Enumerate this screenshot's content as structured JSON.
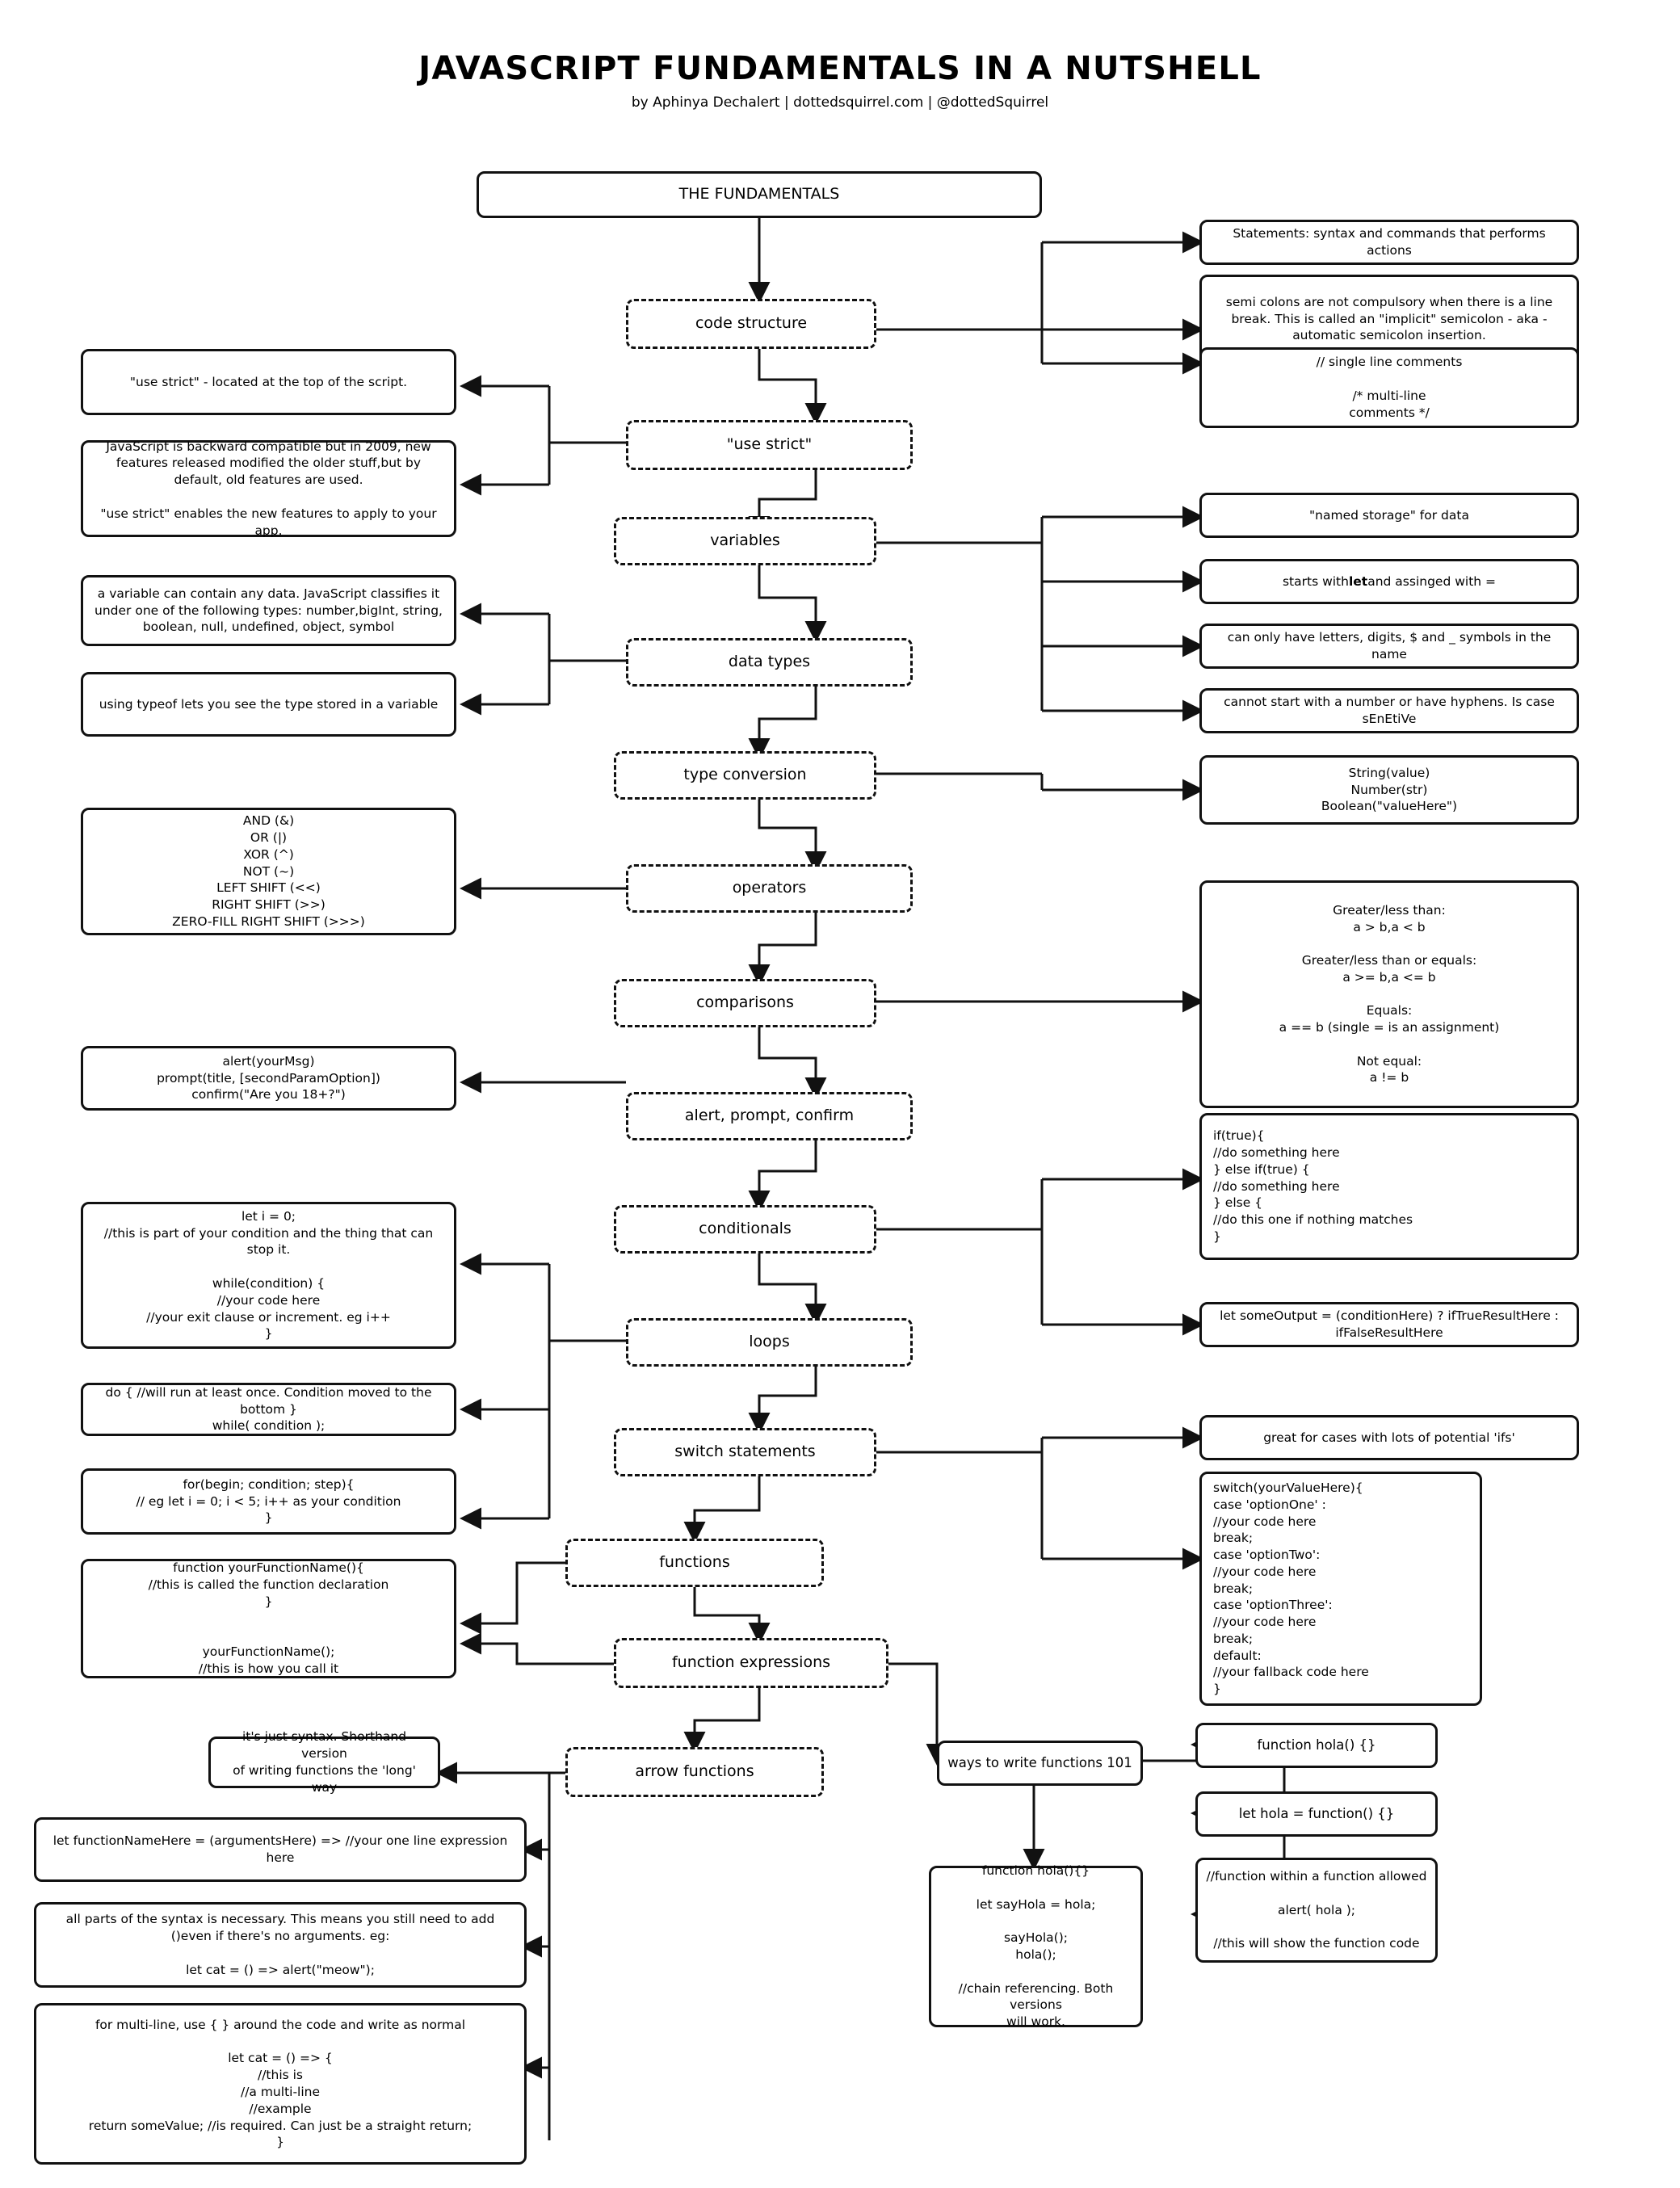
{
  "header": {
    "title": "JAVASCRIPT FUNDAMENTALS IN A NUTSHELL",
    "byline": "by Aphinya Dechalert | dottedsquirrel.com | @dottedSquirrel"
  },
  "root": {
    "label": "THE FUNDAMENTALS"
  },
  "spine": [
    {
      "id": "code-structure",
      "label": "code structure"
    },
    {
      "id": "use-strict",
      "label": "\"use strict\""
    },
    {
      "id": "variables",
      "label": "variables"
    },
    {
      "id": "data-types",
      "label": "data types"
    },
    {
      "id": "type-conversion",
      "label": "type conversion"
    },
    {
      "id": "operators",
      "label": "operators"
    },
    {
      "id": "comparisons",
      "label": "comparisons"
    },
    {
      "id": "alert-prompt-confirm",
      "label": "alert, prompt, confirm"
    },
    {
      "id": "conditionals",
      "label": "conditionals"
    },
    {
      "id": "loops",
      "label": "loops"
    },
    {
      "id": "switch-statements",
      "label": "switch statements"
    },
    {
      "id": "functions",
      "label": "functions"
    },
    {
      "id": "function-expressions",
      "label": "function expressions"
    },
    {
      "id": "arrow-functions",
      "label": "arrow functions"
    }
  ],
  "right_notes": {
    "statements": "Statements: syntax and commands that performs actions",
    "semicolons": "semi colons are not compulsory when there is a line break. This is called an \"implicit\" semicolon - aka - automatic semicolon insertion.",
    "comments": "// single line comments\n\n/* multi-line\ncomments */",
    "named_storage": "\"named storage\" for data",
    "starts_with_let_pre": "starts with ",
    "starts_with_let_bold": "let",
    "starts_with_let_post": " and assinged with =",
    "name_chars": "can only have letters, digits, $ and _ symbols in the name",
    "name_rules": "cannot start with a number or have hyphens. Is case sEnEtiVe",
    "type_conversion": "String(value)\nNumber(str)\nBoolean(\"valueHere\")",
    "comparisons": "Greater/less than:\na > b,a < b\n\nGreater/less than or equals:\na >= b,a <= b\n\nEquals:\na == b (single = is an assignment)\n\nNot equal:\na != b",
    "if_else": "if(true){\n   //do something here\n} else if(true) {\n   //do something here\n} else {\n   //do this one if nothing matches\n}",
    "ternary": "let someOutput = (conditionHere) ? ifTrueResultHere : ifFalseResultHere",
    "switch_good_for": "great for cases with lots of potential 'ifs'",
    "switch_code": "switch(yourValueHere){\ncase 'optionOne' :\n  //your code here\n  break;\ncase 'optionTwo':\n  //your code here\n  break;\ncase 'optionThree':\n  //your code here\n  break;\ndefault:\n  //your fallback code here\n}"
  },
  "left_notes": {
    "use_strict_location": "\"use strict\" - located at the top of the script.",
    "backward_compatible": "JavaScript is backward compatible but in 2009, new features released modified the older stuff,but by default, old features are used.\n\n\"use strict\" enables the new features to apply to your app.",
    "variable_types": "a variable can contain any data. JavaScript classifies it under one of the following types: number,bigInt, string, boolean, null, undefined, object, symbol",
    "typeof": "using typeof lets you see the type stored in a variable",
    "bitwise_operators": "AND (&)\nOR (|)\nXOR (^)\nNOT (~)\nLEFT SHIFT (<<)\nRIGHT SHIFT (>>)\nZERO-FILL RIGHT SHIFT (>>>)",
    "alert_prompt": "alert(yourMsg)\nprompt(title, [secondParamOption])\nconfirm(\"Are you 18+?\")",
    "while_loop": "let i = 0;\n//this is part of your condition and the thing that can stop it.\n\nwhile(condition) {\n//your code here\n//your exit clause or increment. eg i++\n}",
    "do_while": "do { //will run at least once. Condition moved to the bottom }\nwhile( condition );",
    "for_loop": "for(begin; condition; step){\n// eg let i = 0; i < 5; i++ as your condition\n}",
    "function_declaration": "function yourFunctionName(){\n//this is called the function declaration\n}\n\n\nyourFunctionName();\n//this is how you call it",
    "arrow_shorthand": "it's just syntax. Shorthand version\nof writing functions the 'long' way",
    "arrow_syntax": "let functionNameHere = (argumentsHere) => //your one line expression here",
    "arrow_parens": "all parts of the syntax is necessary. This means you still need to add ()even if there's no arguments. eg:\n\nlet cat = () => alert(\"meow\");",
    "arrow_multiline": "for multi-line, use { } around the code and write as normal\n\nlet cat = () => {\n//this is\n//a multi-line\n//example\nreturn someValue; //is required. Can just be a straight return;\n}"
  },
  "function_branch": {
    "ways_to_write": "ways to write functions 101",
    "declaration": "function hola() {}",
    "expression": "let hola = function() {}",
    "nested": "//function within a function allowed\n\nalert( hola );\n\n//this will show the function code",
    "chain_reference": "function hola(){}\n\nlet sayHola = hola;\n\nsayHola();\nhola();\n\n//chain referencing. Both versions\nwill work."
  }
}
